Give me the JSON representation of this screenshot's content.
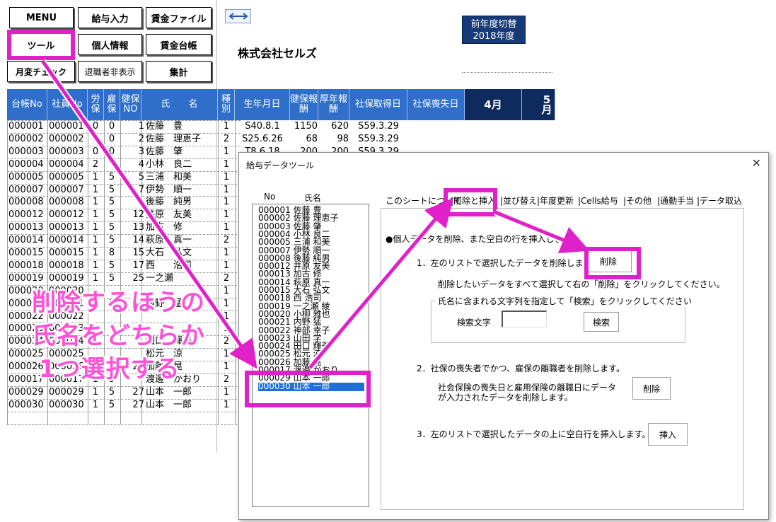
{
  "toolbar": {
    "menu": "MENU",
    "kyuyo_input": "給与入力",
    "chingin_file": "賃金ファイル",
    "tool": "ツール",
    "kojin_joho": "個人情報",
    "chingin_daicho": "賃金台帳",
    "tsukihen_check": "月変チェック",
    "taishoku_hide": "退職者非表示",
    "shukei": "集計",
    "prev_year_line1": "前年度切替",
    "prev_year_line2": "2018年度"
  },
  "company_name": "株式会社セルズ",
  "sheet": {
    "headers": [
      "台帳No",
      "社員No",
      "労保",
      "雇保",
      "健保NO",
      "氏　　名",
      "種別",
      "生年月日",
      "健保報酬",
      "厚年報酬",
      "社保取得日",
      "社保喪失日",
      "4月",
      "5月"
    ],
    "rows": [
      [
        "000001",
        "000001",
        "0",
        "0",
        "1",
        "佐藤　豊",
        "1",
        "S40.8.1",
        "1150",
        "620",
        "S59.3.29"
      ],
      [
        "000002",
        "000002",
        "0",
        "0",
        "2",
        "佐藤　理恵子",
        "2",
        "S25.6.26",
        "68",
        "98",
        "S59.3.29"
      ],
      [
        "000003",
        "000003",
        "0",
        "0",
        "3",
        "佐藤　肇",
        "1",
        "T8.6.18",
        "200",
        "200",
        "S59.3.29"
      ],
      [
        "000004",
        "000004",
        "2",
        "",
        "4",
        "小林　良二",
        "1",
        "",
        "",
        "",
        ""
      ],
      [
        "000005",
        "000005",
        "1",
        "5",
        "5",
        "三浦　和美",
        "1",
        "",
        "",
        "",
        ""
      ],
      [
        "000007",
        "000007",
        "1",
        "5",
        "7",
        "伊勢　順一",
        "1",
        "",
        "",
        "",
        ""
      ],
      [
        "000008",
        "000008",
        "1",
        "5",
        "",
        "後藤　純男",
        "1",
        "",
        "",
        "",
        ""
      ],
      [
        "000012",
        "000012",
        "1",
        "5",
        "12",
        "井原　友美",
        "1",
        "",
        "",
        "",
        ""
      ],
      [
        "000013",
        "000013",
        "1",
        "5",
        "13",
        "加古　修",
        "1",
        "",
        "",
        "",
        ""
      ],
      [
        "000014",
        "000014",
        "1",
        "5",
        "14",
        "萩原　真一",
        "2",
        "",
        "",
        "",
        ""
      ],
      [
        "000015",
        "000015",
        "1",
        "8",
        "15",
        "大石　弘文",
        "1",
        "",
        "",
        "",
        ""
      ],
      [
        "000018",
        "000018",
        "1",
        "5",
        "17",
        "西　　浩司",
        "1",
        "",
        "",
        "",
        ""
      ],
      [
        "000019",
        "000019",
        "1",
        "5",
        "25",
        "一之瀬",
        "2",
        "",
        "",
        "",
        ""
      ],
      [
        "000020",
        "000020",
        "",
        "",
        "",
        "",
        "1",
        "",
        "",
        "",
        ""
      ],
      [
        "000021",
        "000021",
        "1",
        "5",
        "19",
        "内野　猛",
        "1",
        "",
        "",
        "",
        ""
      ],
      [
        "000022",
        "000022",
        "",
        "",
        "",
        "",
        "1",
        "",
        "",
        "",
        ""
      ],
      [
        "000023",
        "000023",
        "",
        "",
        "",
        "",
        "1",
        "",
        "",
        "",
        ""
      ],
      [
        "000024",
        "000024",
        "",
        "",
        "",
        "田口　輝美",
        "2",
        "",
        "",
        "",
        ""
      ],
      [
        "000025",
        "000025",
        "",
        "",
        "",
        "松元　涼",
        "1",
        "",
        "",
        "",
        ""
      ],
      [
        "000026",
        "000026",
        "1",
        "5",
        "23",
        "加藤　晃",
        "1",
        "",
        "",
        "",
        ""
      ],
      [
        "000017",
        "000017",
        "1",
        "5",
        "",
        "渡邊　かおり",
        "2",
        "",
        "",
        "",
        ""
      ],
      [
        "000029",
        "000029",
        "1",
        "5",
        "27",
        "山本　一郎",
        "1",
        "",
        "",
        "",
        ""
      ],
      [
        "000030",
        "000030",
        "1",
        "5",
        "27",
        "山本　一郎",
        "1",
        "",
        "",
        "",
        ""
      ]
    ]
  },
  "dialog": {
    "title": "給与データツール",
    "close": "✕",
    "list_header_no": "No",
    "list_header_name": "氏名",
    "list_items": [
      "000001  佐藤 豊",
      "000002  佐藤 理恵子",
      "000003  佐藤 肇",
      "000004  小林 良二",
      "000005  三浦 和美",
      "000007  伊勢 順一",
      "000008  後藤 純男",
      "000012  井原 友美",
      "000013  加古 修",
      "000014  萩原 真一",
      "000015  大石 弘文",
      "000018  西 浩司",
      "000019  一之瀬 綾",
      "000020  小柳 雅也",
      "000021  内野 猛",
      "000022  神部 幸子",
      "000023  山田 学",
      "000024  田口 輝美",
      "000025  松元 涼",
      "000026  加藤 晃",
      "000017  渡邊 かおり",
      "000029  山本 一郎",
      "000030  山本 一郎"
    ],
    "tabs": [
      "このシートについて",
      "削除と挿入",
      "並び替え",
      "年度更新",
      "Cells給与",
      "その他",
      "通勤手当",
      "データ取込"
    ],
    "section_heading": "●個人データを削除、また空白の行を挿入しま",
    "item1": "1．左のリストで選択したデータを削除しま",
    "item1_desc": "削除したいデータをすべて選択して右の「削除」をクリックしてください。",
    "search_group": "氏名に含まれる文字列を指定して「検索」をクリックしてください",
    "search_label": "検索文字",
    "search_value": "",
    "search_button": "検索",
    "delete_button": "削除",
    "item2": "2．社保の喪失者でかつ、雇保の離職者を削除します。",
    "item2_desc_line1": "社会保険の喪失日と雇用保険の離職日にデータ",
    "item2_desc_line2": "が入力されたデータを削除します。",
    "delete_button2": "削除",
    "item3": "3．左のリストで選択したデータの上に空白行を挿入します。",
    "insert_button": "挿入"
  },
  "annotation": {
    "line1": "削除するほうの",
    "line2": "氏名をどちらか",
    "line3": "1つ選択する"
  },
  "colors": {
    "highlight": "#e020c8",
    "header_blue": "#2f6fc9",
    "header_dark": "#0f2a5c",
    "selection": "#1e6fd9"
  }
}
